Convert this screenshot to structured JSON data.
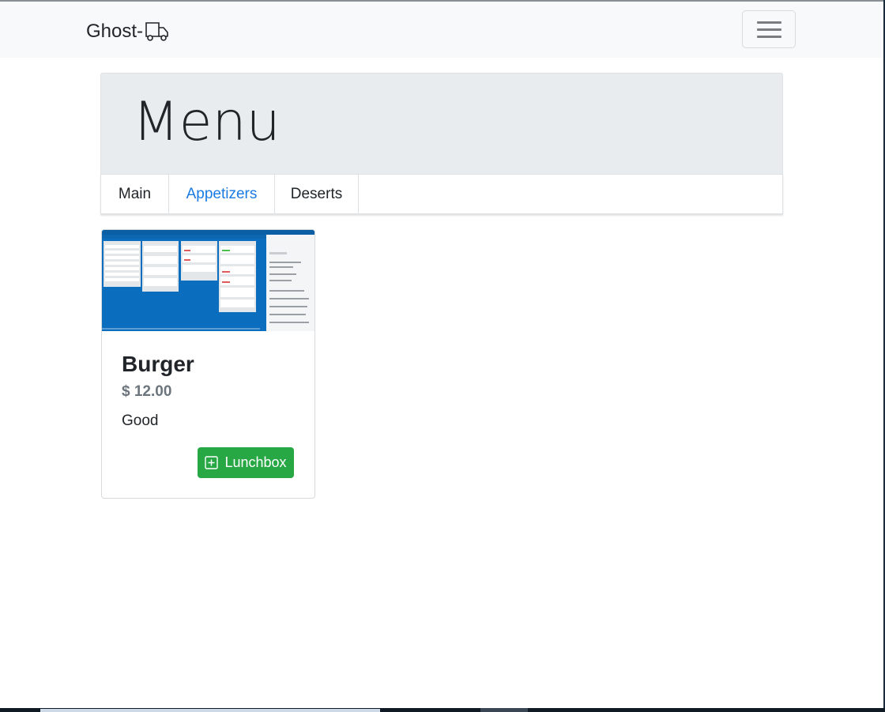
{
  "navbar": {
    "brand": "Ghost-",
    "brand_icon": "truck-icon",
    "toggler_icon": "hamburger-icon"
  },
  "header": {
    "title": "Menu"
  },
  "tabs": [
    {
      "label": "Main",
      "active": false
    },
    {
      "label": "Appetizers",
      "active": true
    },
    {
      "label": "Deserts",
      "active": false
    }
  ],
  "items": [
    {
      "image": "kanban-board-screenshot",
      "name": "Burger",
      "price": "$ 12.00",
      "description": "Good",
      "button_label": "Lunchbox",
      "button_icon": "plus-square-icon"
    }
  ],
  "colors": {
    "accent": "#1a7be3",
    "success": "#28a745",
    "muted": "#6c757d"
  }
}
